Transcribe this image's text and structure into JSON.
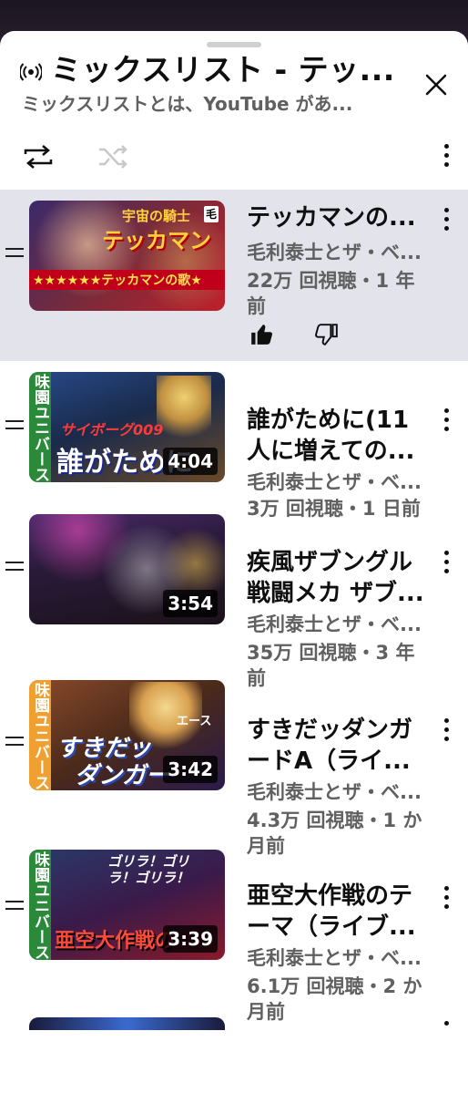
{
  "playlist": {
    "title": "ミックスリスト - テッ...",
    "subtitle": "ミックスリストとは、YouTube があ..."
  },
  "icons": {
    "live": "broadcast-icon",
    "close": "close-icon",
    "loop": "loop-icon",
    "shuffle": "shuffle-icon",
    "more": "more-vert-icon",
    "like": "thumb-up-icon",
    "dislike": "thumb-down-icon",
    "drag": "drag-handle-icon"
  },
  "colors": {
    "active_row": "#e3e3ec",
    "secondary_text": "#606060"
  },
  "videos": [
    {
      "title": "テッカマンの...",
      "channel": "毛利泰士とザ・ベ...",
      "meta": "22万 回視聴・1 年前",
      "duration": "",
      "active": true,
      "thumb_text": {
        "top": "宇宙の騎士",
        "main": "テッカマン",
        "banner": "★★★★★★テッカマンの歌★"
      }
    },
    {
      "title": "誰がために(11人に増えての...",
      "channel": "毛利泰士とザ・ベ...",
      "meta": "3万 回視聴・1 日前",
      "duration": "4:04",
      "thumb_text": {
        "side": "味園ユニバース",
        "main": "誰がために",
        "sub": "サイボーグ009"
      }
    },
    {
      "title": "疾風ザブングル戦闘メカ ザブ...",
      "channel": "毛利泰士とザ・ベ...",
      "meta": "35万 回視聴・3 年前",
      "duration": "3:54",
      "thumb_text": {}
    },
    {
      "title": "すきだッダンガードA（ライ...",
      "channel": "毛利泰士とザ・ベ...",
      "meta": "4.3万 回視聴・1 か月前",
      "duration": "3:42",
      "thumb_text": {
        "side": "味園ユニバース",
        "main": "すきだッ",
        "main2": "ダンガー",
        "sub": "エース"
      }
    },
    {
      "title": "亜空大作戦のテーマ（ライブ...",
      "channel": "毛利泰士とザ・ベ...",
      "meta": "6.1万 回視聴・2 か月前",
      "duration": "3:39",
      "thumb_text": {
        "side": "味園ユニバース",
        "main": "亜空大作戦の",
        "sub": "ゴリラ！ゴリラ！ゴリラ！"
      }
    }
  ]
}
